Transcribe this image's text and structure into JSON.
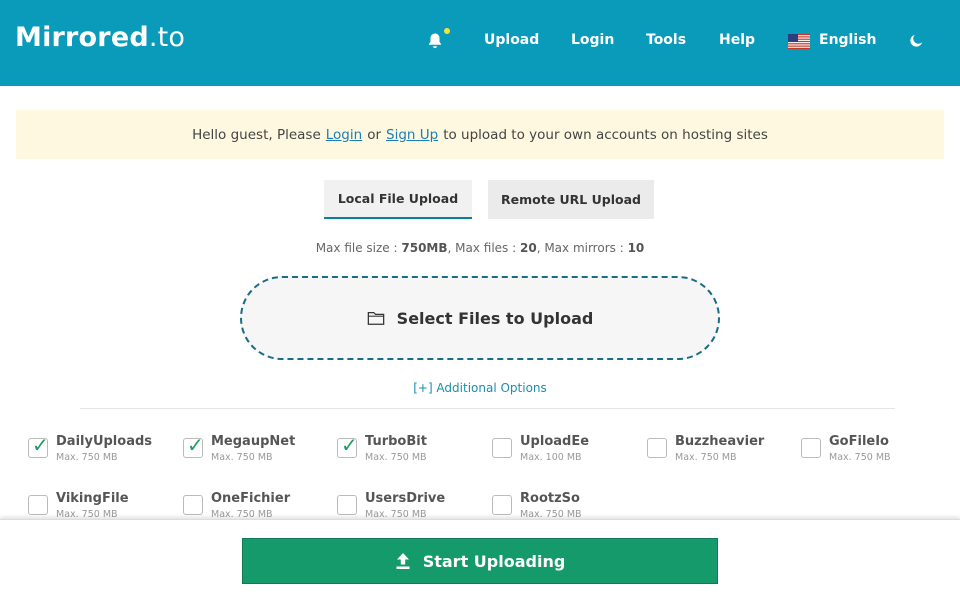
{
  "header": {
    "logo_main": "Mirrored",
    "logo_tld": ".to",
    "nav": {
      "upload": "Upload",
      "login": "Login",
      "tools": "Tools",
      "help": "Help",
      "language": "English"
    },
    "icons": [
      "bell-icon",
      "us-flag-icon",
      "moon-icon"
    ],
    "colors": {
      "bar": "#0a9bba",
      "notification_dot": "#f5e33b"
    }
  },
  "notice": {
    "prefix": "Hello guest, Please",
    "login_link": "Login",
    "or": "or",
    "signup_link": "Sign Up",
    "suffix": "to upload to your own accounts on hosting sites"
  },
  "tabs": {
    "local": "Local File Upload",
    "remote": "Remote URL Upload",
    "active": "Local File Upload"
  },
  "limits": {
    "size_label": "Max file size :",
    "size_value": "750MB",
    "files_label": ", Max files :",
    "files_value": "20",
    "mirrors_label": ", Max mirrors :",
    "mirrors_value": "10"
  },
  "dropzone": {
    "label": "Select Files to Upload",
    "icon": "folder-icon"
  },
  "additional_options": "[+] Additional Options",
  "hosts": [
    {
      "name": "DailyUploads",
      "max": "Max. 750 MB",
      "checked": true
    },
    {
      "name": "MegaupNet",
      "max": "Max. 750 MB",
      "checked": true
    },
    {
      "name": "TurboBit",
      "max": "Max. 750 MB",
      "checked": true
    },
    {
      "name": "UploadEe",
      "max": "Max. 100 MB",
      "checked": false
    },
    {
      "name": "Buzzheavier",
      "max": "Max. 750 MB",
      "checked": false
    },
    {
      "name": "GoFileIo",
      "max": "Max. 750 MB",
      "checked": false
    },
    {
      "name": "VikingFile",
      "max": "Max. 750 MB",
      "checked": false
    },
    {
      "name": "OneFichier",
      "max": "Max. 750 MB",
      "checked": false
    },
    {
      "name": "UsersDrive",
      "max": "Max. 750 MB",
      "checked": false
    },
    {
      "name": "RootzSo",
      "max": "Max. 750 MB",
      "checked": false
    }
  ],
  "start_button": {
    "label": "Start Uploading",
    "icon": "upload-icon",
    "color": "#149a6b"
  }
}
